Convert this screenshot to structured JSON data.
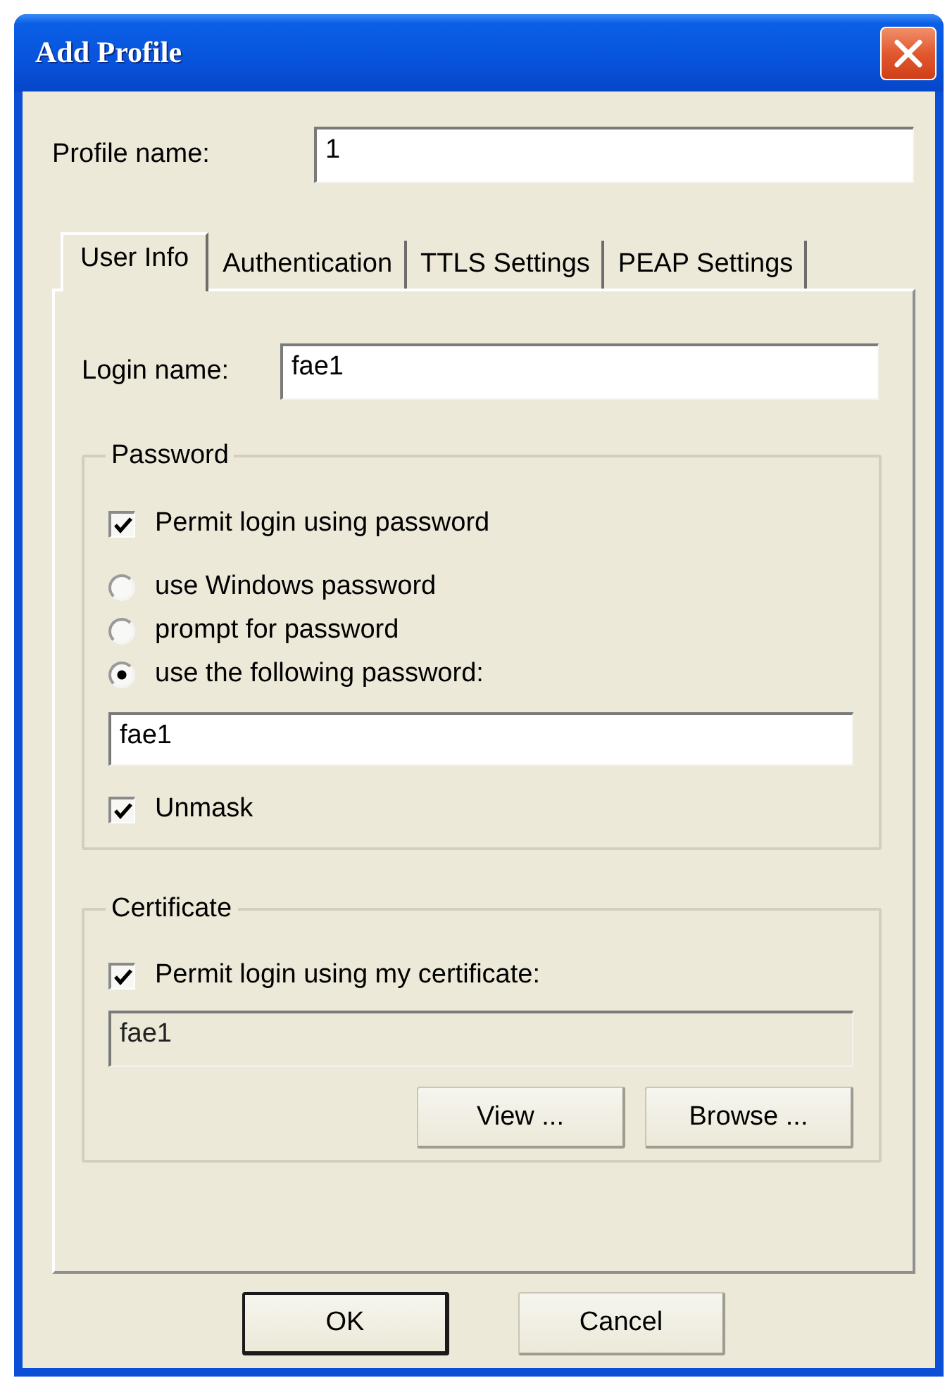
{
  "window": {
    "title": "Add Profile"
  },
  "profile_name": {
    "label": "Profile name:",
    "value": "1"
  },
  "tabs": [
    {
      "label": "User Info",
      "selected": true
    },
    {
      "label": "Authentication",
      "selected": false
    },
    {
      "label": "TTLS Settings",
      "selected": false
    },
    {
      "label": "PEAP Settings",
      "selected": false
    }
  ],
  "user_info": {
    "login_name": {
      "label": "Login name:",
      "value": "fae1"
    },
    "password_group": {
      "title": "Password",
      "permit": {
        "label": "Permit login using password",
        "checked": true
      },
      "options": [
        {
          "label": "use Windows password",
          "selected": false
        },
        {
          "label": "prompt for password",
          "selected": false
        },
        {
          "label": "use the following password:",
          "selected": true
        }
      ],
      "password": {
        "value": "fae1",
        "disabled": false
      },
      "unmask": {
        "label": "Unmask",
        "checked": true
      }
    },
    "certificate_group": {
      "title": "Certificate",
      "permit": {
        "label": "Permit login using my certificate:",
        "checked": true
      },
      "certificate": {
        "value": "fae1",
        "disabled": true
      },
      "buttons": [
        {
          "label": "View ..."
        },
        {
          "label": "Browse ..."
        }
      ]
    }
  },
  "buttons": [
    {
      "label": "OK",
      "default": true
    },
    {
      "label": "Cancel",
      "default": false
    }
  ]
}
